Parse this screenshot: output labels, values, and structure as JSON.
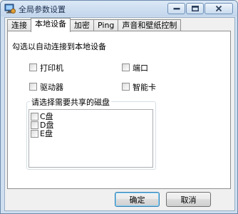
{
  "window": {
    "title": "全局参数设置"
  },
  "tabs": [
    "连接",
    "本地设备",
    "加密",
    "Ping",
    "声音和壁纸控制"
  ],
  "local_devices": {
    "hint": "勾选以自动连接到本地设备",
    "options": {
      "printer": "打印机",
      "port": "端口",
      "drives": "驱动器",
      "smartcard": "智能卡"
    },
    "share_group": {
      "label": "请选择需要共享的磁盘",
      "disks": [
        "C盘",
        "D盘",
        "E盘"
      ]
    }
  },
  "buttons": {
    "ok": "确定",
    "cancel": "取消"
  }
}
